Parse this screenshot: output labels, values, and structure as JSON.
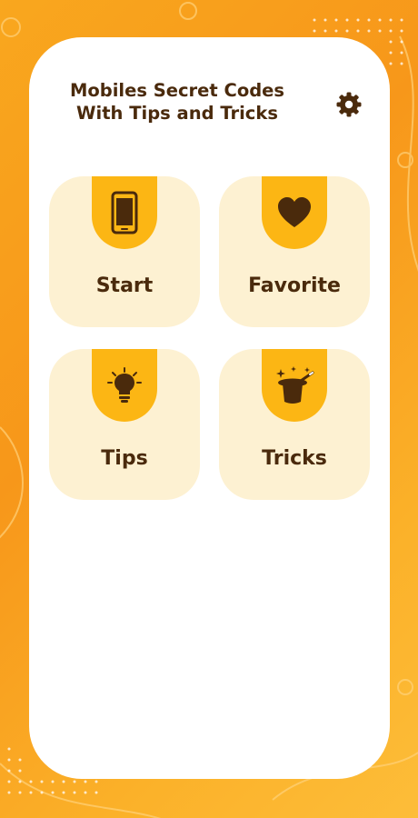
{
  "app": {
    "title": "Mobiles Secret Codes\nWith Tips and Tricks",
    "settings_icon": "gear-icon"
  },
  "menu": {
    "items": [
      {
        "label": "Start",
        "icon": "smartphone-icon"
      },
      {
        "label": "Favorite",
        "icon": "heart-icon"
      },
      {
        "label": "Tips",
        "icon": "lightbulb-icon"
      },
      {
        "label": "Tricks",
        "icon": "magic-hat-icon"
      }
    ]
  },
  "colors": {
    "background_orange": "#f9a71e",
    "card": "#ffffff",
    "tile": "#fdf1d2",
    "tab": "#fcb614",
    "text_dark_brown": "#4a2a0c"
  }
}
